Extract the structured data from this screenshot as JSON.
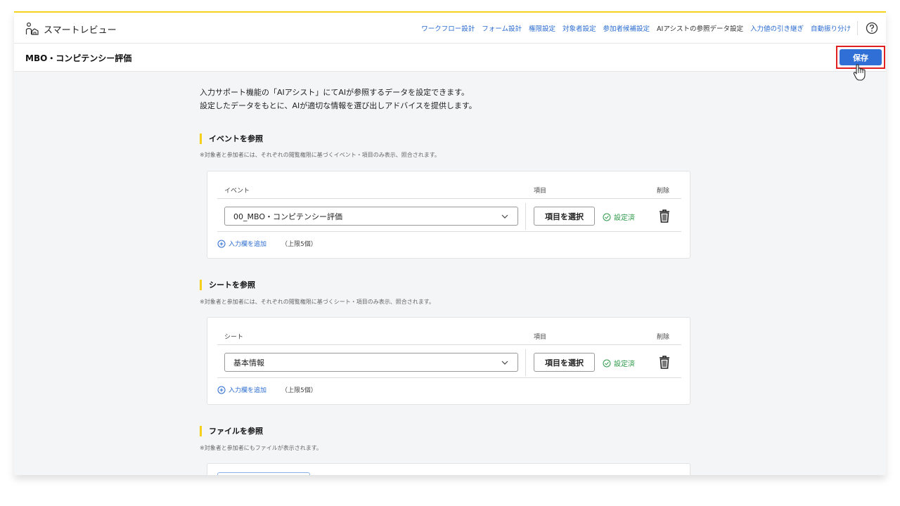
{
  "app": {
    "name": "スマートレビュー"
  },
  "nav": [
    {
      "label": "ワークフロー設計",
      "active": false
    },
    {
      "label": "フォーム設計",
      "active": false
    },
    {
      "label": "権限設定",
      "active": false
    },
    {
      "label": "対象者設定",
      "active": false
    },
    {
      "label": "参加者候補設定",
      "active": false
    },
    {
      "label": "AIアシストの参照データ設定",
      "active": true
    },
    {
      "label": "入力値の引き継ぎ",
      "active": false
    },
    {
      "label": "自動振り分け",
      "active": false
    }
  ],
  "page": {
    "title": "MBO・コンピテンシー評価",
    "save_label": "保存"
  },
  "intro": {
    "line1": "入力サポート機能の「AIアシスト」にてAIが参照するデータを設定できます。",
    "line2": "設定したデータをもとに、AIが適切な情報を選び出しアドバイスを提供します。"
  },
  "event_section": {
    "title": "イベントを参照",
    "note": "※対象者と参加者には、それぞれの閲覧権限に基づくイベント・項目のみ表示、照合されます。",
    "col_main": "イベント",
    "col_item": "項目",
    "col_delete": "削除",
    "selected": "00_MBO・コンピテンシー評価",
    "item_button": "項目を選択",
    "status": "設定済",
    "add_label": "入力欄を追加",
    "limit": "（上限5個）"
  },
  "sheet_section": {
    "title": "シートを参照",
    "note": "※対象者と参加者には、それぞれの閲覧権限に基づくシート・項目のみ表示、照合されます。",
    "col_main": "シート",
    "col_item": "項目",
    "col_delete": "削除",
    "selected": "基本情報",
    "item_button": "項目を選択",
    "status": "設定済",
    "add_label": "入力欄を追加",
    "limit": "（上限5個）"
  },
  "file_section": {
    "title": "ファイルを参照",
    "note": "※対象者と参加者にもファイルが表示されます。"
  },
  "colors": {
    "accent": "#2f6fd6",
    "highlight": "#f5cf1c",
    "success": "#2f9a4a",
    "alert_outline": "#e02020"
  }
}
